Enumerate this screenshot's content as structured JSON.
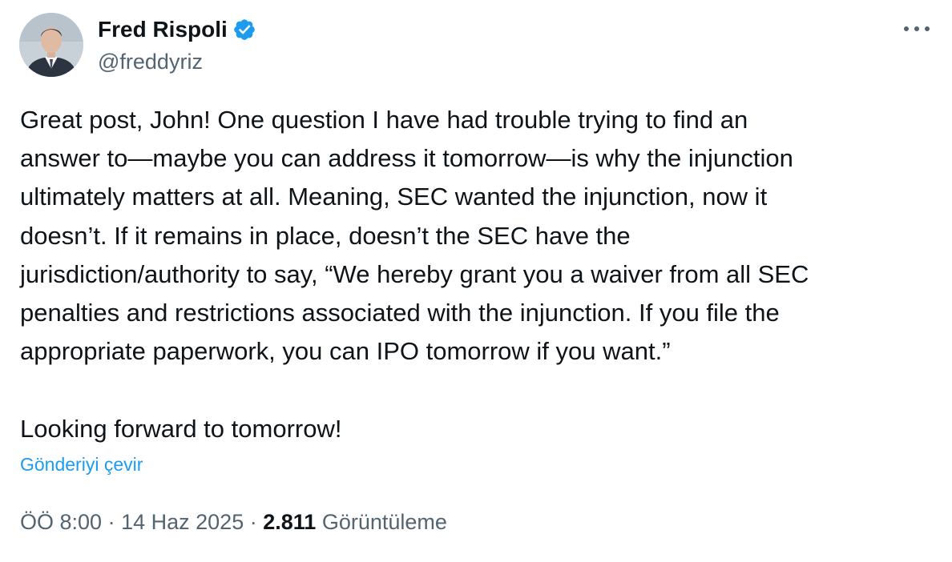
{
  "author": {
    "name": "Fred Rispoli",
    "handle": "@freddyriz",
    "verified_color": "#1d9bf0"
  },
  "more_icon": "more-horizontal-icon",
  "tweet": {
    "lines": [
      "Great post, John! One question I have had trouble trying to find an",
      "answer to—maybe you can address it tomorrow—is why the injunction",
      "ultimately matters at all. Meaning, SEC wanted the injunction, now it",
      "doesn’t. If it remains in place, doesn’t the SEC have the",
      "jurisdiction/authority to say, “We hereby grant you a waiver from all SEC",
      "penalties and restrictions associated with the injunction. If you file the",
      "appropriate paperwork, you can IPO tomorrow if you want.”"
    ],
    "closing_line": "Looking forward to tomorrow!"
  },
  "translate_label": "Gönderiyi çevir",
  "meta": {
    "time": "ÖÖ 8:00",
    "separator": "·",
    "date": "14 Haz 2025",
    "views_count": "2.811",
    "views_label": "Görüntüleme"
  },
  "colors": {
    "link": "#1d9bf0",
    "secondary_text": "#536471",
    "primary_text": "#0f1419"
  }
}
